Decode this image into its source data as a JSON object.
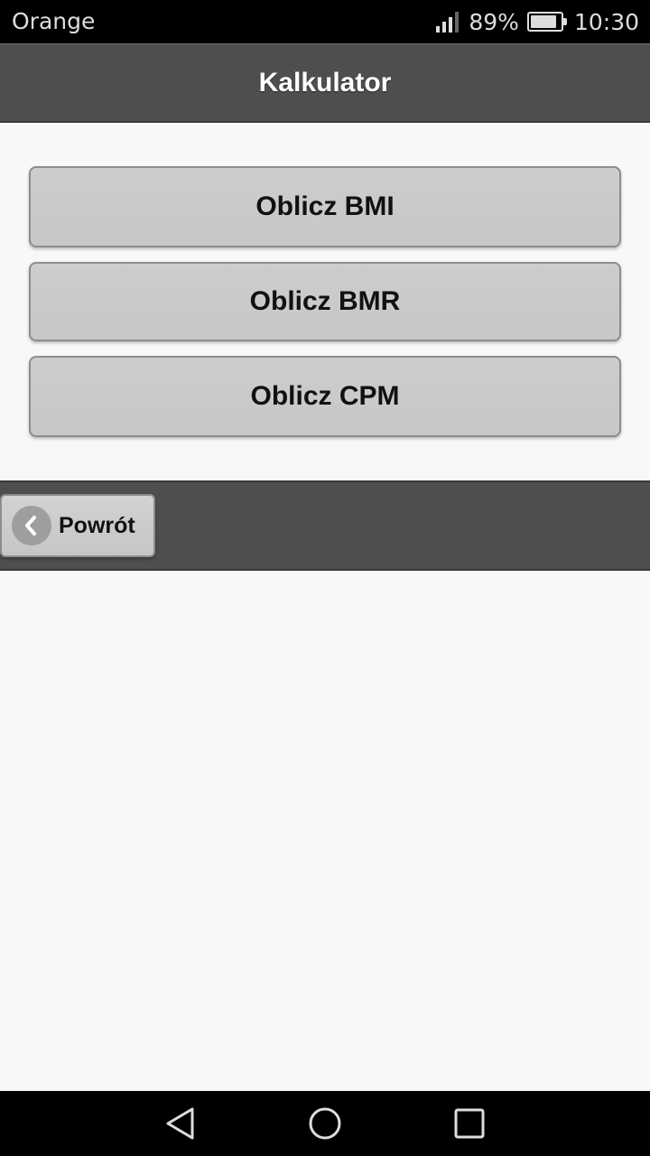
{
  "status_bar": {
    "carrier": "Orange",
    "battery_percent": "89%",
    "battery_level": 0.89,
    "time": "10:30",
    "signal_bars": 3,
    "signal_max": 4
  },
  "header": {
    "title": "Kalkulator"
  },
  "buttons": {
    "bmi": "Oblicz BMI",
    "bmr": "Oblicz BMR",
    "cpm": "Oblicz CPM"
  },
  "footer": {
    "back_label": "Powrót",
    "back_icon": "chevron-left-icon"
  },
  "nav_bar": {
    "icons": [
      "back-triangle-icon",
      "home-circle-icon",
      "recent-square-icon"
    ]
  },
  "colors": {
    "header_bg": "#4e4e4e",
    "button_bg": "#c9c9c9",
    "page_bg": "#f8f8f8",
    "status_bg": "#000000"
  }
}
